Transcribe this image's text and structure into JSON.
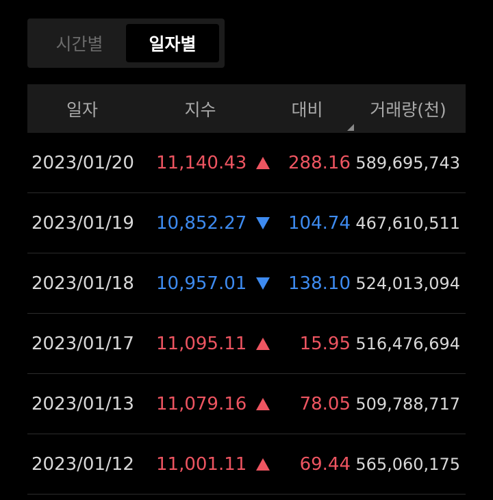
{
  "toggle": {
    "options": [
      {
        "label": "시간별",
        "active": false
      },
      {
        "label": "일자별",
        "active": true
      }
    ]
  },
  "table": {
    "headers": {
      "date": "일자",
      "index": "지수",
      "change": "대비",
      "volume": "거래량(천)"
    },
    "rows": [
      {
        "date": "2023/01/20",
        "index": "11,140.43",
        "direction": "up",
        "change": "288.16",
        "volume": "589,695,743"
      },
      {
        "date": "2023/01/19",
        "index": "10,852.27",
        "direction": "down",
        "change": "104.74",
        "volume": "467,610,511"
      },
      {
        "date": "2023/01/18",
        "index": "10,957.01",
        "direction": "down",
        "change": "138.10",
        "volume": "524,013,094"
      },
      {
        "date": "2023/01/17",
        "index": "11,095.11",
        "direction": "up",
        "change": "15.95",
        "volume": "516,476,694"
      },
      {
        "date": "2023/01/13",
        "index": "11,079.16",
        "direction": "up",
        "change": "78.05",
        "volume": "509,788,717"
      },
      {
        "date": "2023/01/12",
        "index": "11,001.11",
        "direction": "up",
        "change": "69.44",
        "volume": "565,060,175"
      }
    ]
  },
  "colors": {
    "up": "#ee5561",
    "down": "#3e8bf0"
  },
  "icons": {
    "up": "triangle-up-icon",
    "down": "triangle-down-icon",
    "sort": "sort-corner-icon"
  }
}
